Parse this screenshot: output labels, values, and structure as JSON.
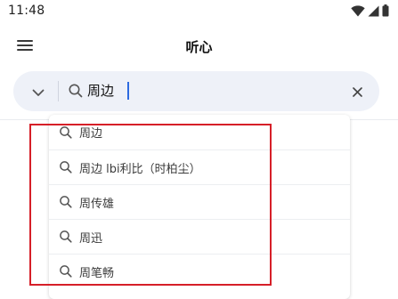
{
  "status_bar": {
    "time": "11:48",
    "icons": [
      "wifi-icon",
      "signal-icon",
      "battery-icon"
    ]
  },
  "app_bar": {
    "title": "听心",
    "menu_icon": "menu-icon"
  },
  "search": {
    "value": "周边",
    "dropdown_icon": "chevron-down-icon",
    "search_icon": "search-icon",
    "clear_icon": "close-icon"
  },
  "suggestions": [
    {
      "label": "周边",
      "icon": "search-icon"
    },
    {
      "label": "周边 lbi利比（时柏尘）",
      "icon": "search-icon"
    },
    {
      "label": "周传雄",
      "icon": "search-icon"
    },
    {
      "label": "周迅",
      "icon": "search-icon"
    },
    {
      "label": "周笔畅",
      "icon": "search-icon"
    }
  ],
  "colors": {
    "search_bg": "#eef1f8",
    "caret": "#2d6ae0",
    "highlight": "#d61f28"
  }
}
